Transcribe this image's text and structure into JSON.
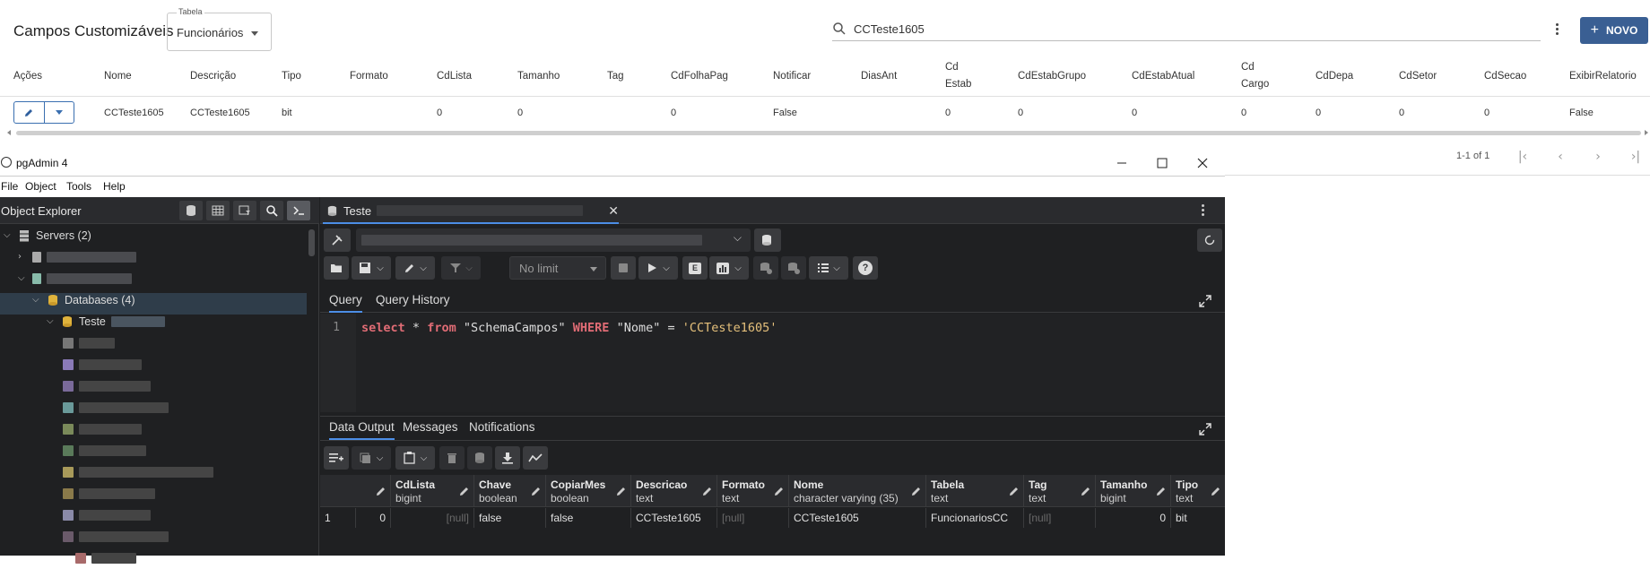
{
  "webapp": {
    "title": "Campos Customizáveis",
    "table_select": {
      "legend": "Tabela",
      "value": "Funcionários"
    },
    "search": {
      "value": "CCTeste1605"
    },
    "new_button": "NOVO",
    "columns": [
      {
        "key": "acoes",
        "label": "Ações"
      },
      {
        "key": "nome",
        "label": "Nome"
      },
      {
        "key": "descricao",
        "label": "Descrição"
      },
      {
        "key": "tipo",
        "label": "Tipo"
      },
      {
        "key": "formato",
        "label": "Formato"
      },
      {
        "key": "cdlista",
        "label": "CdLista"
      },
      {
        "key": "tamanho",
        "label": "Tamanho"
      },
      {
        "key": "tag",
        "label": "Tag"
      },
      {
        "key": "cdfolhapag",
        "label": "CdFolhaPag"
      },
      {
        "key": "notificar",
        "label": "Notificar"
      },
      {
        "key": "diasant",
        "label": "DiasAnt"
      },
      {
        "key": "cdestab",
        "label": "Cd Estab"
      },
      {
        "key": "cdestabgrupo",
        "label": "CdEstabGrupo"
      },
      {
        "key": "cdestabatual",
        "label": "CdEstabAtual"
      },
      {
        "key": "cdcargo",
        "label": "Cd Cargo"
      },
      {
        "key": "cddepa",
        "label": "CdDepa"
      },
      {
        "key": "cdsetor",
        "label": "CdSetor"
      },
      {
        "key": "cdsecao",
        "label": "CdSecao"
      },
      {
        "key": "exibirrelatorio",
        "label": "ExibirRelatorio"
      }
    ],
    "row": {
      "nome": "CCTeste1605",
      "descricao": "CCTeste1605",
      "tipo": "bit",
      "formato": "",
      "cdlista": "0",
      "tamanho": "0",
      "tag": "",
      "cdfolhapag": "0",
      "notificar": "False",
      "diasant": "",
      "cdestab": "0",
      "cdestabgrupo": "0",
      "cdestabatual": "0",
      "cdcargo": "0",
      "cddepa": "0",
      "cdsetor": "0",
      "cdsecao": "0",
      "exibirrelatorio": "False"
    },
    "pagination": {
      "range": "1-1 of 1"
    }
  },
  "pgadmin": {
    "window_title": "pgAdmin 4",
    "menu": [
      "File",
      "Object",
      "Tools",
      "Help"
    ],
    "object_explorer": {
      "title": "Object Explorer",
      "servers_label": "Servers (2)",
      "databases_label": "Databases (4)",
      "selected_db_label": "Teste"
    },
    "query_tab_label": "Teste",
    "limit_select": "No limit",
    "panel_tabs": [
      "Query",
      "Query History"
    ],
    "editor": {
      "line_number": "1",
      "sql": {
        "select": "select",
        "star": "*",
        "from": "from",
        "table": "\"SchemaCampos\"",
        "where": "WHERE",
        "column": "\"Nome\"",
        "eq": "=",
        "value": "'CCTeste1605'"
      }
    },
    "output_tabs": [
      "Data Output",
      "Messages",
      "Notifications"
    ],
    "grid": {
      "columns": [
        {
          "name": "CdLista",
          "type": "bigint"
        },
        {
          "name": "Chave",
          "type": "boolean"
        },
        {
          "name": "CopiarMes",
          "type": "boolean"
        },
        {
          "name": "Descricao",
          "type": "text"
        },
        {
          "name": "Formato",
          "type": "text"
        },
        {
          "name": "Nome",
          "type": "character varying (35)"
        },
        {
          "name": "Tabela",
          "type": "text"
        },
        {
          "name": "Tag",
          "type": "text"
        },
        {
          "name": "Tamanho",
          "type": "bigint"
        },
        {
          "name": "Tipo",
          "type": "text"
        }
      ],
      "row_number": "1",
      "first_cell": "0",
      "row": [
        "[null]",
        "false",
        "false",
        "CCTeste1605",
        "[null]",
        "CCTeste1605",
        "FuncionariosCC",
        "[null]",
        "0",
        "bit"
      ]
    }
  }
}
